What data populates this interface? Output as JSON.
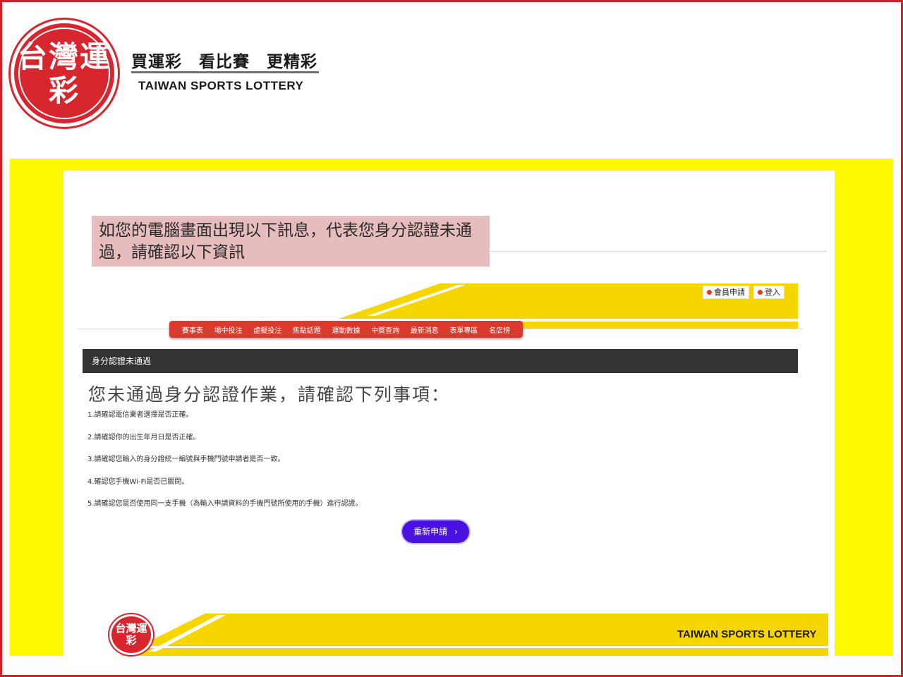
{
  "header": {
    "logo_text": "台灣運彩",
    "slogan": "買運彩　看比賽　更精彩",
    "brand_en": "TAIWAN SPORTS LOTTERY"
  },
  "notice": {
    "text": "如您的電腦畫面出現以下訊息，代表您身分認證未通過，請確認以下資訊"
  },
  "site": {
    "top_links": [
      {
        "label": "會員申請"
      },
      {
        "label": "登入"
      }
    ],
    "nav": [
      "賽事表",
      "場中投注",
      "虛擬投注",
      "焦點話題",
      "運動數據",
      "中獎查詢",
      "最新消息",
      "表單專區",
      "名店榜"
    ],
    "status_bar": "身分認證未通過",
    "main_title": "您未通過身分認證作業，請確認下列事項：",
    "items": [
      "1.請確認電信業者選擇是否正確。",
      "2.請確認你的出生年月日是否正確。",
      "3.請確認您輸入的身分證統一編號與手機門號申請者是否一致。",
      "4.確認您手機Wi-Fi是否已關閉。",
      "5.請確認您是否使用同一支手機（為輸入申請資料的手機門號所使用的手機）進行認證。"
    ],
    "retry_button": "重新申請"
  },
  "footer": {
    "logo_text": "台灣運彩",
    "brand_en": "TAIWAN SPORTS LOTTERY"
  },
  "colors": {
    "border_red": "#d0212a",
    "yellow": "#fcf900",
    "nav_red": "#d93a2b",
    "button_purple": "#4a12e0"
  }
}
